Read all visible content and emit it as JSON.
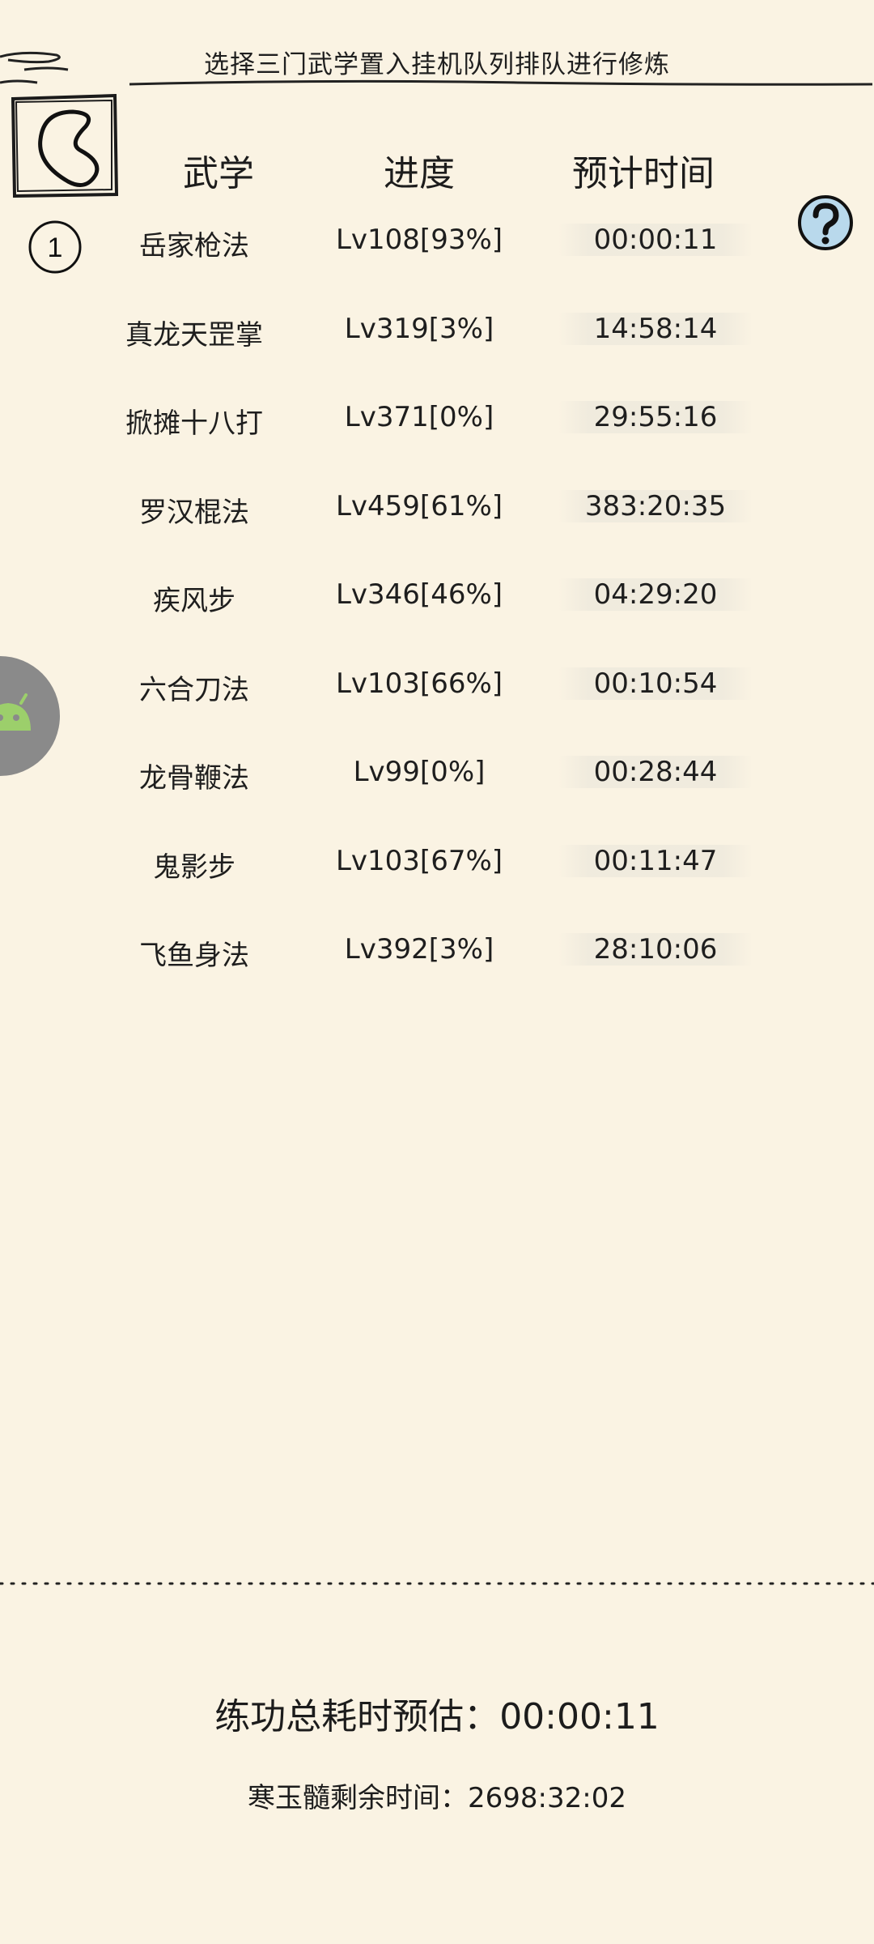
{
  "header": {
    "title": "选择三门武学置入挂机队列排队进行修炼"
  },
  "columns": {
    "skill": "武学",
    "progress": "进度",
    "eta": "预计时间"
  },
  "queue_marker": "1",
  "skills": [
    {
      "name": "岳家枪法",
      "progress": "Lv108[93%]",
      "eta": "00:00:11"
    },
    {
      "name": "真龙天罡掌",
      "progress": "Lv319[3%]",
      "eta": "14:58:14"
    },
    {
      "name": "掀摊十八打",
      "progress": "Lv371[0%]",
      "eta": "29:55:16"
    },
    {
      "name": "罗汉棍法",
      "progress": "Lv459[61%]",
      "eta": "383:20:35"
    },
    {
      "name": "疾风步",
      "progress": "Lv346[46%]",
      "eta": "04:29:20"
    },
    {
      "name": "六合刀法",
      "progress": "Lv103[66%]",
      "eta": "00:10:54"
    },
    {
      "name": "龙骨鞭法",
      "progress": "Lv99[0%]",
      "eta": "00:28:44"
    },
    {
      "name": "鬼影步",
      "progress": "Lv103[67%]",
      "eta": "00:11:47"
    },
    {
      "name": "飞鱼身法",
      "progress": "Lv392[3%]",
      "eta": "28:10:06"
    }
  ],
  "footer": {
    "total_label": "练功总耗时预估：",
    "total_value": "00:00:11",
    "remain_label": "寒玉髓剩余时间：",
    "remain_value": "2698:32:02"
  },
  "colors": {
    "background": "#faf3e3",
    "ink": "#1c1c1c",
    "help_fill": "#b9d9ec",
    "widget_gray": "#8a8a8a",
    "widget_green": "#9ccf6b"
  },
  "icons": {
    "back": "back-arrow-icon",
    "help": "question-mark-icon",
    "side_widget": "android-robot-icon",
    "queue_marker": "circled-number-icon"
  }
}
